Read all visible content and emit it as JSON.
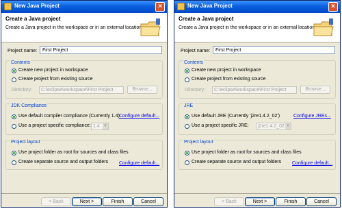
{
  "windows": {
    "left": {
      "title": "New Java Project",
      "banner_title": "Create a Java project",
      "banner_desc": "Create a Java project in the workspace or in an external location.",
      "name_label": "Project name:",
      "name_value": "First Project",
      "contents": {
        "title": "Contents",
        "opt1": "Create new project in workspace",
        "opt2": "Create project from existing source",
        "dir_label": "Directory:",
        "dir_value": "C:\\eclipse\\workspace\\First Project",
        "browse": "Browse..."
      },
      "middle": {
        "title": "JDK Compliance",
        "opt1": "Use default compiler compliance (Currently 1.4)",
        "opt1_link": "Configure default...",
        "opt2": "Use a project specific compliance:",
        "select_value": "1.4"
      },
      "layout": {
        "title": "Project layout",
        "opt1": "Use project folder as root for sources and class files",
        "opt2": "Create separate source and output folders",
        "link": "Configure default..."
      },
      "buttons": {
        "back": "< Back",
        "next": "Next >",
        "finish": "Finish",
        "cancel": "Cancel"
      }
    },
    "right": {
      "title": "New Java Project",
      "banner_title": "Create a Java project",
      "banner_desc": "Create a Java project in the workspace or in an external location.",
      "name_label": "Project name:",
      "name_value": "First Project",
      "contents": {
        "title": "Contents",
        "opt1": "Create new project in workspace",
        "opt2": "Create project from existing source",
        "dir_label": "Directory:",
        "dir_value": "C:\\eclipse\\workspace\\First Project",
        "browse": "Browse..."
      },
      "middle": {
        "title": "JRE",
        "opt1": "Use default JRE (Currently 'j2re1.4.2_02')",
        "opt1_link": "Configure JREs...",
        "opt2": "Use a project specific JRE:",
        "select_value": "j2re1.4.2_02"
      },
      "layout": {
        "title": "Project layout",
        "opt1": "Use project folder as root for sources and class files",
        "opt2": "Create separate source and output folders",
        "link": "Configure default..."
      },
      "buttons": {
        "back": "< Back",
        "next": "Next >",
        "finish": "Finish",
        "cancel": "Cancel"
      }
    }
  },
  "icons": {
    "title_icon": "java-project-icon",
    "close": "close-icon",
    "banner": "folder-wizard-icon"
  },
  "colors": {
    "titlebar": "#0a5fe0",
    "group_title": "#0046d5",
    "link": "#0000ee",
    "radio_dot": "#21a121"
  }
}
